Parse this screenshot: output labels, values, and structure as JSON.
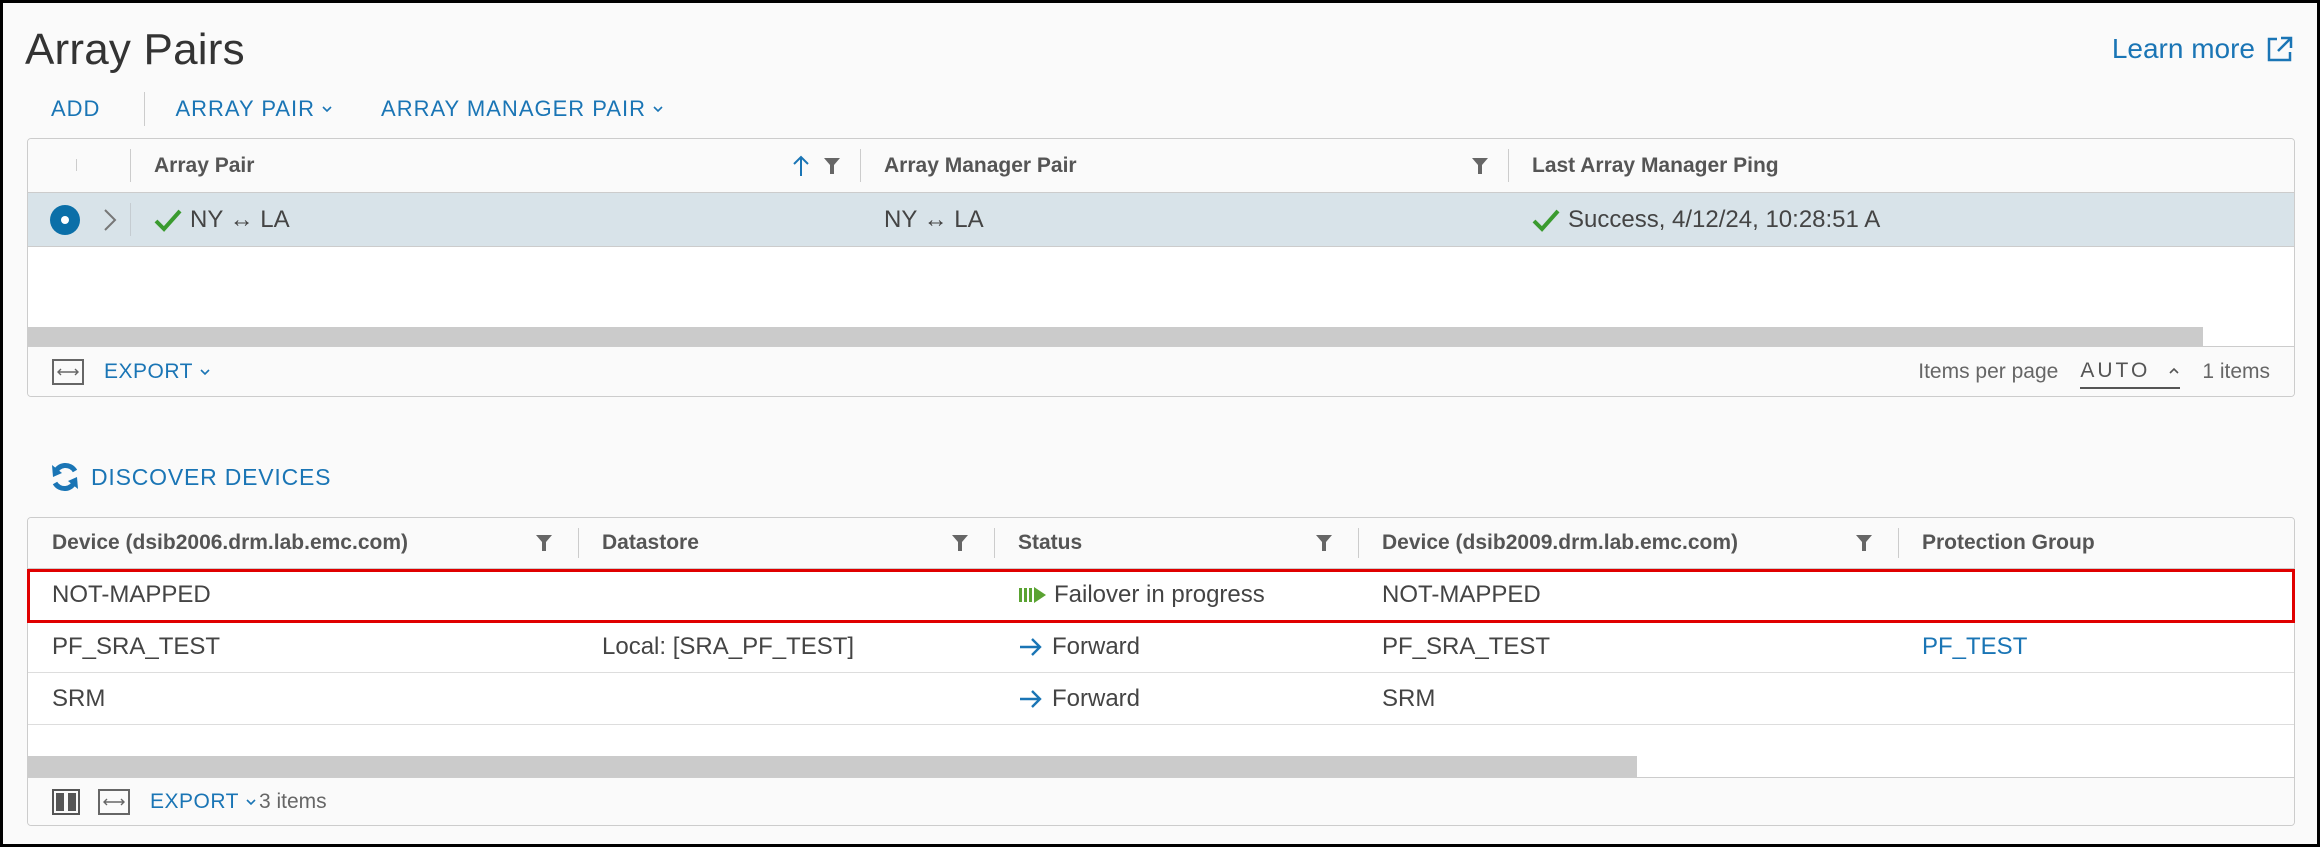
{
  "page": {
    "title": "Array Pairs",
    "learn_more": "Learn more"
  },
  "toolbar": {
    "add": "ADD",
    "array_pair": "ARRAY PAIR",
    "array_manager_pair": "ARRAY MANAGER PAIR"
  },
  "array_pairs_grid": {
    "columns": [
      {
        "label": "Array Pair",
        "sorted": "ascending",
        "filter": true
      },
      {
        "label": "Array Manager Pair",
        "filter": true
      },
      {
        "label": "Last Array Manager Ping"
      }
    ],
    "rows": [
      {
        "selected": true,
        "array_pair": "NY ↔ LA",
        "array_pair_status": "ok",
        "array_manager_pair": "NY ↔ LA",
        "last_ping": "Success, 4/12/24, 10:28:51 A",
        "last_ping_status": "ok"
      }
    ],
    "footer": {
      "export": "EXPORT",
      "items_per_page_label": "Items per page",
      "items_per_page_value": "AUTO",
      "items_count": "1 items"
    },
    "scroll_fraction_visible": 0.96
  },
  "discover_devices": {
    "label": "DISCOVER DEVICES"
  },
  "devices_grid": {
    "columns": [
      {
        "label": "Device (dsib2006.drm.lab.emc.com)",
        "filter": true
      },
      {
        "label": "Datastore",
        "filter": true
      },
      {
        "label": "Status",
        "filter": true
      },
      {
        "label": "Device (dsib2009.drm.lab.emc.com)",
        "filter": true
      },
      {
        "label": "Protection Group"
      }
    ],
    "rows": [
      {
        "device_local": "NOT-MAPPED",
        "datastore": "",
        "status": "Failover in progress",
        "status_type": "failover",
        "device_remote": "NOT-MAPPED",
        "protection_group": "",
        "highlighted": true
      },
      {
        "device_local": "PF_SRA_TEST",
        "datastore": "Local: [SRA_PF_TEST]",
        "status": "Forward",
        "status_type": "forward",
        "device_remote": "PF_SRA_TEST",
        "protection_group": "PF_TEST"
      },
      {
        "device_local": "SRM",
        "datastore": "",
        "status": "Forward",
        "status_type": "forward",
        "device_remote": "SRM",
        "protection_group": ""
      }
    ],
    "footer": {
      "export": "EXPORT",
      "items_count": "3 items"
    },
    "scroll_fraction_visible": 0.71
  },
  "colors": {
    "accent": "#1a75b5",
    "success": "#3a9b2f",
    "failover": "#5aa332",
    "highlight": "#e00000",
    "selected_row": "#d8e3e9"
  }
}
